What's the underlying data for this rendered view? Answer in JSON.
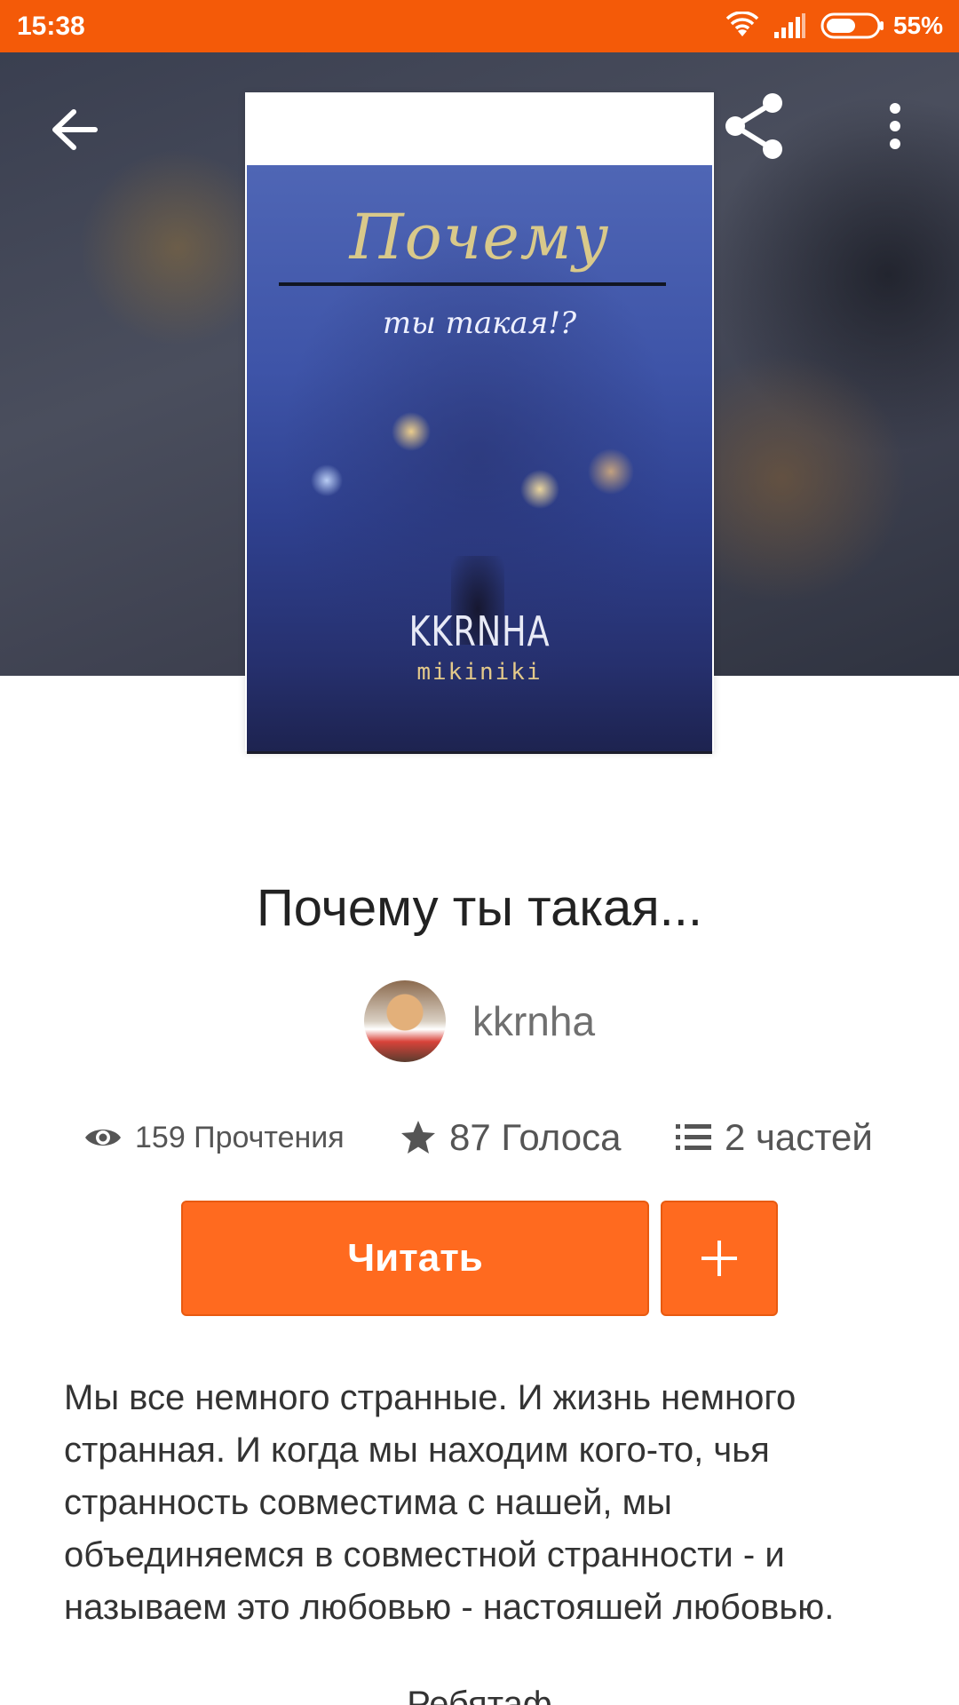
{
  "status_bar": {
    "time": "15:38",
    "battery_percent": "55%",
    "icons": [
      "wifi-icon",
      "signal-icon",
      "battery-icon"
    ]
  },
  "toolbar": {
    "icons": [
      "back-arrow-icon",
      "share-icon",
      "more-vert-icon"
    ]
  },
  "cover": {
    "title": "Почему",
    "subtitle": "ты такая!?",
    "author": "KKRNHA",
    "coauthor": "mikiniki"
  },
  "book": {
    "title": "Почему ты такая...",
    "author": "kkrnha",
    "stats": {
      "reads": "159 Прочтения",
      "votes": "87 Голоса",
      "parts": "2 частей"
    },
    "read_button": "Читать",
    "add_button": "+",
    "description": "Мы все немного странные. И жизнь немного странная. И когда мы находим кого-то, чья странность совместима с нашей, мы объединяемся в совместной странности - и называем это любовью - настояшей любовью.",
    "footer_peek": "Ребятаф"
  },
  "colors": {
    "accent": "#ff6a1f",
    "status_bar": "#f45a08",
    "header_bg": "#3e4150",
    "text_primary": "#222222",
    "text_secondary": "#555555"
  }
}
